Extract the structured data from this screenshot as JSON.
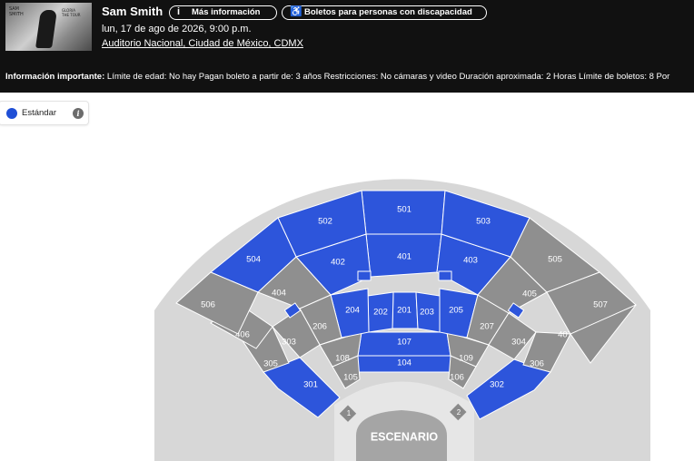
{
  "event": {
    "artist": "Sam Smith",
    "more_info_label": "Más información",
    "accessibility_label": "Boletos para personas con discapacidad",
    "date": "lun, 17 de ago de 2026, 9:00 p.m.",
    "venue": "Auditorio Nacional, Ciudad de México, CDMX"
  },
  "info_bar": {
    "heading": "Información importante:",
    "text": " Límite de edad: No hay Pagan boleto a partir de: 3 años Restricciones: No cámaras y video Duración aproximada: 2 Horas Límite de boletos: 8 Por"
  },
  "legend": {
    "items": [
      {
        "label": "Estándar",
        "color": "#1f4fd6"
      }
    ]
  },
  "colors": {
    "available": "#2d55db",
    "unavailable": "#8f8f8f",
    "stage": "#bdbdbd",
    "aisle": "#d7d7d7"
  },
  "seat_map": {
    "stage_label": "ESCENARIO",
    "gates": [
      "1",
      "2"
    ],
    "sections": [
      {
        "id": "501",
        "available": true
      },
      {
        "id": "502",
        "available": true
      },
      {
        "id": "503",
        "available": true
      },
      {
        "id": "504",
        "available": true
      },
      {
        "id": "505",
        "available": false
      },
      {
        "id": "506",
        "available": false
      },
      {
        "id": "507",
        "available": false
      },
      {
        "id": "401",
        "available": true
      },
      {
        "id": "402",
        "available": true
      },
      {
        "id": "403",
        "available": true
      },
      {
        "id": "404",
        "available": false
      },
      {
        "id": "405",
        "available": false
      },
      {
        "id": "406",
        "available": false
      },
      {
        "id": "407",
        "available": false
      },
      {
        "id": "201",
        "available": true
      },
      {
        "id": "202",
        "available": true
      },
      {
        "id": "203",
        "available": true
      },
      {
        "id": "204",
        "available": true
      },
      {
        "id": "205",
        "available": true
      },
      {
        "id": "206",
        "available": false
      },
      {
        "id": "207",
        "available": false
      },
      {
        "id": "301",
        "available": true
      },
      {
        "id": "302",
        "available": true
      },
      {
        "id": "303",
        "available": false
      },
      {
        "id": "304",
        "available": false
      },
      {
        "id": "305",
        "available": false
      },
      {
        "id": "306",
        "available": false
      },
      {
        "id": "107",
        "available": true
      },
      {
        "id": "104",
        "available": true
      },
      {
        "id": "105",
        "available": false
      },
      {
        "id": "106",
        "available": false
      },
      {
        "id": "108",
        "available": false
      },
      {
        "id": "109",
        "available": false
      }
    ],
    "small_boxes": [
      "BOX",
      "BOX",
      "BOX",
      "BOX"
    ]
  }
}
